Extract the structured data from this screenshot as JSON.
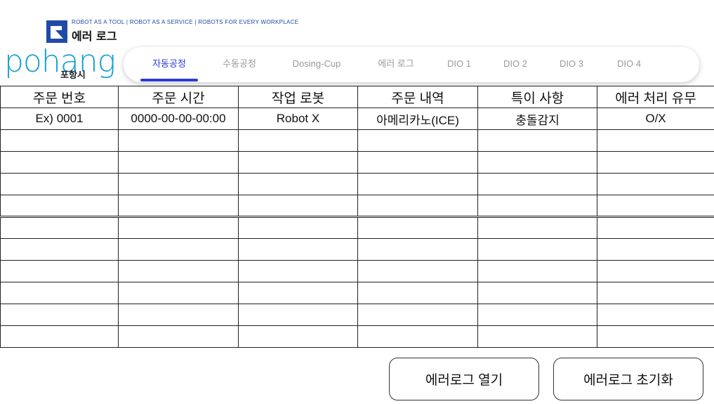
{
  "header": {
    "tagline": "ROBOT AS A TOOL | ROBOT AS A SERVICE | ROBOTS FOR EVERY WORKPLACE",
    "title": "에러 로그",
    "city_word": "pohang",
    "city_sub": "포항시"
  },
  "tabs": [
    {
      "label": "자동공정",
      "active": true
    },
    {
      "label": "수동공정",
      "active": false
    },
    {
      "label": "Dosing-Cup",
      "active": false
    },
    {
      "label": "에러 로그",
      "active": false
    },
    {
      "label": "DIO 1",
      "active": false
    },
    {
      "label": "DIO 2",
      "active": false
    },
    {
      "label": "DIO 3",
      "active": false
    },
    {
      "label": "DIO 4",
      "active": false
    }
  ],
  "table": {
    "headers": [
      "주문 번호",
      "주문 시간",
      "작업 로봇",
      "주문 내역",
      "특이 사항",
      "에러 처리 유무"
    ],
    "rows": [
      [
        "Ex) 0001",
        "0000-00-00-00:00",
        "Robot X",
        "아메리카노(ICE)",
        "충돌감지",
        "O/X"
      ],
      [
        "",
        "",
        "",
        "",
        "",
        ""
      ],
      [
        "",
        "",
        "",
        "",
        "",
        ""
      ],
      [
        "",
        "",
        "",
        "",
        "",
        ""
      ],
      [
        "",
        "",
        "",
        "",
        "",
        ""
      ],
      [
        "",
        "",
        "",
        "",
        "",
        ""
      ],
      [
        "",
        "",
        "",
        "",
        "",
        ""
      ],
      [
        "",
        "",
        "",
        "",
        "",
        ""
      ],
      [
        "",
        "",
        "",
        "",
        "",
        ""
      ],
      [
        "",
        "",
        "",
        "",
        "",
        ""
      ],
      [
        "",
        "",
        "",
        "",
        "",
        ""
      ]
    ]
  },
  "buttons": {
    "open_label": "에러로그 열기",
    "reset_label": "에러로그 초기화"
  },
  "colors": {
    "accent": "#2b3bd6",
    "logo_blue": "#1aa0d6",
    "brand_blue": "#1f4aa8"
  }
}
